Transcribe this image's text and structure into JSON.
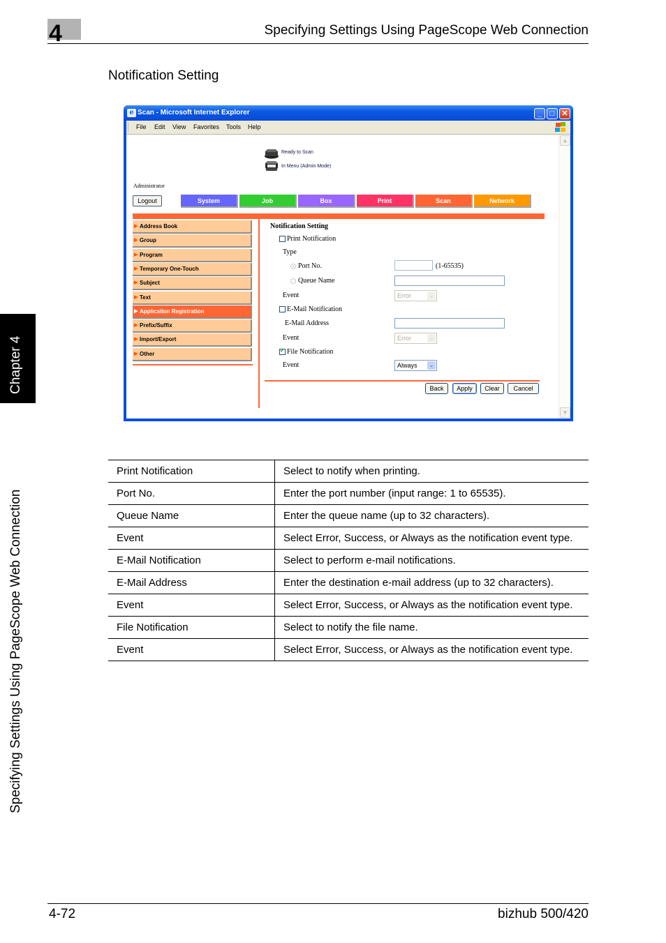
{
  "page_header": {
    "chapter_number": "4",
    "running_title": "Specifying Settings Using PageScope Web Connection"
  },
  "section_title": "Notification Setting",
  "side_tab": {
    "chapter_label": "Chapter 4",
    "section_label": "Specifying Settings Using PageScope Web Connection"
  },
  "browser": {
    "window_title": "Scan - Microsoft Internet Explorer",
    "menu": [
      "File",
      "Edit",
      "View",
      "Favorites",
      "Tools",
      "Help"
    ],
    "controls": {
      "minimize": "_",
      "maximize": "□",
      "close": "✕"
    }
  },
  "webpage": {
    "status": [
      {
        "icon": "scanner-icon",
        "text": "Ready to Scan"
      },
      {
        "icon": "printer-icon",
        "text": "In Menu (Admin Mode)"
      }
    ],
    "user_label": "Administrator",
    "logout_label": "Logout",
    "tabs": [
      {
        "label": "System",
        "color": "#6666ff"
      },
      {
        "label": "Job",
        "color": "#33cc33"
      },
      {
        "label": "Box",
        "color": "#9966ff"
      },
      {
        "label": "Print",
        "color": "#ff3366"
      },
      {
        "label": "Scan",
        "color": "#ff6633"
      },
      {
        "label": "Network",
        "color": "#ff9900"
      }
    ],
    "active_tab": "Scan",
    "accent_color": "#ff6633",
    "menu_item_color": "#ffcc99",
    "side_menu": [
      {
        "label": "Address Book",
        "active": false
      },
      {
        "label": "Group",
        "active": false
      },
      {
        "label": "Program",
        "active": false
      },
      {
        "label": "Temporary One-Touch",
        "active": false
      },
      {
        "label": "Subject",
        "active": false
      },
      {
        "label": "Text",
        "active": false
      },
      {
        "label": "Application Registration",
        "active": true
      },
      {
        "label": "Prefix/Suffix",
        "active": false
      },
      {
        "label": "Import/Export",
        "active": false
      },
      {
        "label": "Other",
        "active": false
      }
    ],
    "form": {
      "title": "Notification Setting",
      "print_notification": {
        "label": "Print Notification",
        "checked": false
      },
      "type_label": "Type",
      "port_no": {
        "label": "Port No.",
        "selected": true,
        "value": "",
        "range_hint": "(1-65535)"
      },
      "queue_name": {
        "label": "Queue Name",
        "selected": false,
        "value": ""
      },
      "print_event": {
        "label": "Event",
        "value": "Error",
        "disabled": true
      },
      "email_notification": {
        "label": "E-Mail Notification",
        "checked": false
      },
      "email_address": {
        "label": "E-Mail Address",
        "value": ""
      },
      "email_event": {
        "label": "Event",
        "value": "Error",
        "disabled": true
      },
      "file_notification": {
        "label": "File Notification",
        "checked": true
      },
      "file_event": {
        "label": "Event",
        "value": "Always",
        "disabled": false
      },
      "buttons": {
        "back": "Back",
        "apply": "Apply",
        "clear": "Clear",
        "cancel": "Cancel"
      }
    }
  },
  "description_table": [
    {
      "item": "Print Notification",
      "description": "Select to notify when printing."
    },
    {
      "item": "Port No.",
      "description": "Enter the port number (input range: 1 to 65535)."
    },
    {
      "item": "Queue Name",
      "description": "Enter the queue name (up to 32 characters)."
    },
    {
      "item": "Event",
      "description": "Select Error, Success, or Always as the notification event type."
    },
    {
      "item": "E-Mail Notification",
      "description": "Select to perform e-mail notifications."
    },
    {
      "item": "E-Mail Address",
      "description": "Enter the destination e-mail address (up to 32 characters)."
    },
    {
      "item": "Event",
      "description": "Select Error, Success, or Always as the notification event type."
    },
    {
      "item": "File Notification",
      "description": "Select to notify the file name."
    },
    {
      "item": "Event",
      "description": "Select Error, Success, or Always as the notification event type."
    }
  ],
  "footer": {
    "page_number": "4-72",
    "product": "bizhub 500/420"
  }
}
